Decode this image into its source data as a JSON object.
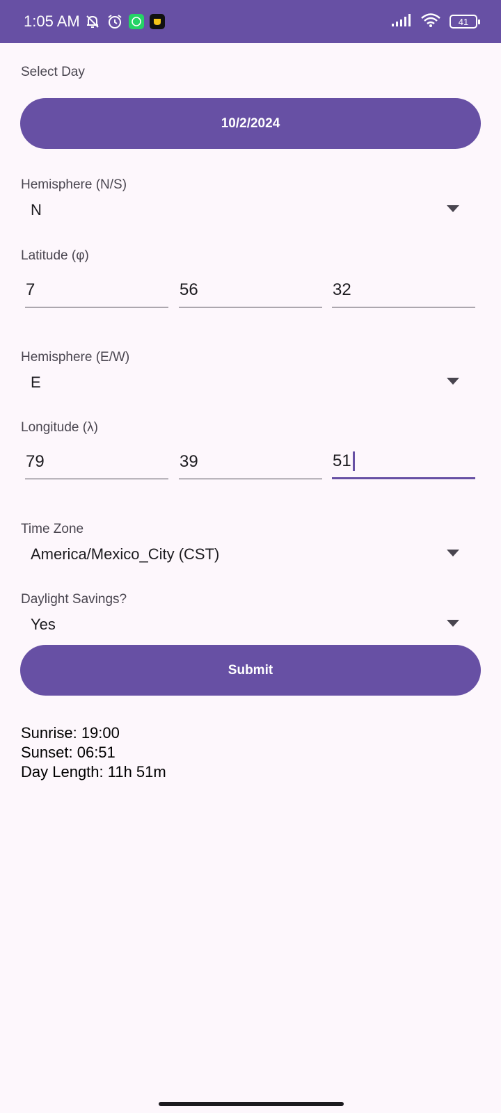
{
  "status_bar": {
    "time": "1:05 AM",
    "battery": "41",
    "icons": [
      "mute-bell-icon",
      "alarm-icon",
      "whatsapp-icon",
      "app-icon",
      "signal-icon",
      "wifi-icon",
      "battery-icon"
    ]
  },
  "colors": {
    "primary": "#6750a4",
    "background": "#fdf7fc"
  },
  "form": {
    "select_day_label": "Select Day",
    "date_button": "10/2/2024",
    "hemisphere_ns_label": "Hemisphere (N/S)",
    "hemisphere_ns_value": "N",
    "latitude_label": "Latitude (φ)",
    "latitude": {
      "deg": "7",
      "min": "56",
      "sec": "32"
    },
    "hemisphere_ew_label": "Hemisphere (E/W)",
    "hemisphere_ew_value": "E",
    "longitude_label": "Longitude (λ)",
    "longitude": {
      "deg": "79",
      "min": "39",
      "sec": "51"
    },
    "timezone_label": "Time Zone",
    "timezone_value": "America/Mexico_City (CST)",
    "dst_label": "Daylight Savings?",
    "dst_value": "Yes",
    "submit_label": "Submit"
  },
  "results": {
    "sunrise": "Sunrise: 19:00",
    "sunset": "Sunset: 06:51",
    "day_length": "Day Length: 11h 51m"
  }
}
